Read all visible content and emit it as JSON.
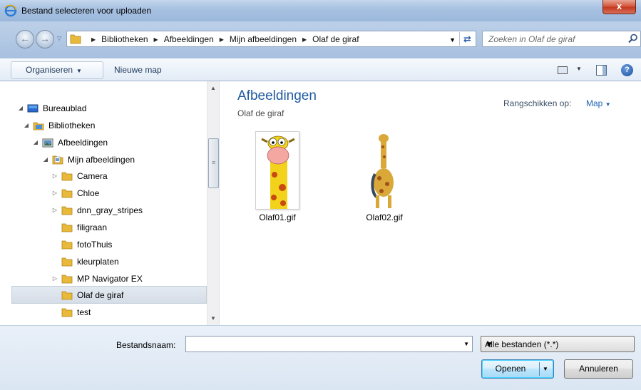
{
  "window": {
    "title": "Bestand selecteren voor uploaden",
    "close_label": "x"
  },
  "address_bar": {
    "breadcrumbs": [
      "Bibliotheken",
      "Afbeeldingen",
      "Mijn afbeeldingen",
      "Olaf de giraf"
    ]
  },
  "search": {
    "placeholder": "Zoeken in Olaf de giraf"
  },
  "toolbar": {
    "organize_label": "Organiseren",
    "new_folder_label": "Nieuwe map"
  },
  "tree": {
    "items": [
      {
        "label": "Bureaublad",
        "icon": "desktop-icon",
        "expander": "expanded"
      },
      {
        "label": "Bibliotheken",
        "icon": "library-icon",
        "expander": "expanded"
      },
      {
        "label": "Afbeeldingen",
        "icon": "pictures-library-icon",
        "expander": "expanded"
      },
      {
        "label": "Mijn afbeeldingen",
        "icon": "folder-doc-icon",
        "expander": "expanded"
      },
      {
        "label": "Camera",
        "icon": "folder-icon",
        "expander": "collapsed"
      },
      {
        "label": "Chloe",
        "icon": "folder-icon",
        "expander": "collapsed"
      },
      {
        "label": "dnn_gray_stripes",
        "icon": "folder-icon",
        "expander": "collapsed"
      },
      {
        "label": "filigraan",
        "icon": "folder-icon",
        "expander": "none"
      },
      {
        "label": "fotoThuis",
        "icon": "folder-icon",
        "expander": "none"
      },
      {
        "label": "kleurplaten",
        "icon": "folder-icon",
        "expander": "none"
      },
      {
        "label": "MP Navigator EX",
        "icon": "folder-icon",
        "expander": "collapsed"
      },
      {
        "label": "Olaf de giraf",
        "icon": "folder-icon",
        "expander": "none",
        "selected": true
      },
      {
        "label": "test",
        "icon": "folder-icon",
        "expander": "none"
      }
    ]
  },
  "content": {
    "library_title": "Afbeeldingen",
    "library_subtitle": "Olaf de giraf",
    "arrange_label": "Rangschikken op:",
    "arrange_value": "Map",
    "files": [
      {
        "name": "Olaf01.gif",
        "thumbnail": "giraffe-face-thumbnail"
      },
      {
        "name": "Olaf02.gif",
        "thumbnail": "giraffe-standing-thumbnail"
      }
    ]
  },
  "bottom": {
    "filename_label": "Bestandsnaam:",
    "filename_value": "",
    "filter_value": "Alle bestanden (*.*)",
    "open_label": "Openen",
    "cancel_label": "Annuleren"
  },
  "colors": {
    "accent_title": "#1e5aa0",
    "link_blue": "#1e64b4",
    "titlebar": "#a9c2e2",
    "close_red": "#c43a1f",
    "folder_yellow": "#e8b93a"
  }
}
